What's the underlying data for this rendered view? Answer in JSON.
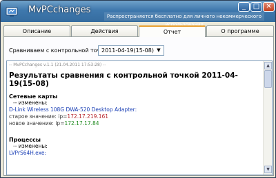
{
  "window": {
    "title": "MvPCchanges",
    "subtitle": "Распространяется бесплатно для личного некоммерческого использования",
    "min_glyph": "_",
    "max_glyph": "□",
    "close_glyph": "✕"
  },
  "tabs": [
    {
      "label": "Описание",
      "active": false
    },
    {
      "label": "Действия",
      "active": false
    },
    {
      "label": "Отчет",
      "active": true
    },
    {
      "label": "О программе",
      "active": false
    }
  ],
  "compare": {
    "label": "Сравниваем с контрольной точкой",
    "selected": "2011-04-19(15-08)",
    "arrow_glyph": "▼"
  },
  "report": {
    "header": "-- MvPCchanges v.1.1 (21.04.2011 17:53:28) --",
    "title": "Результаты сравнения с контрольной точкой 2011-04-19(15-08)",
    "sections": {
      "network": {
        "heading": "Сетевые карты",
        "changed_label": "-- изменены:",
        "adapter": "D-Link Wireless 108G DWA-520 Desktop Adapter:",
        "old_label": "старое значение:",
        "old_prefix": "ip=",
        "old_value": "172.17.219.161",
        "new_label": "новое значение:",
        "new_prefix": "ip=",
        "new_value": "172.17.17.84"
      },
      "processes": {
        "heading": "Процессы",
        "changed_label": "-- изменены:",
        "process": "LVPrS64H.exe:"
      }
    }
  },
  "scroll": {
    "up_glyph": "▲",
    "down_glyph": "▼"
  },
  "colors": {
    "accent_tab": "#e8a030",
    "link": "#1a3fb5",
    "old_value": "#b8252a",
    "new_value": "#1e8a1e"
  }
}
